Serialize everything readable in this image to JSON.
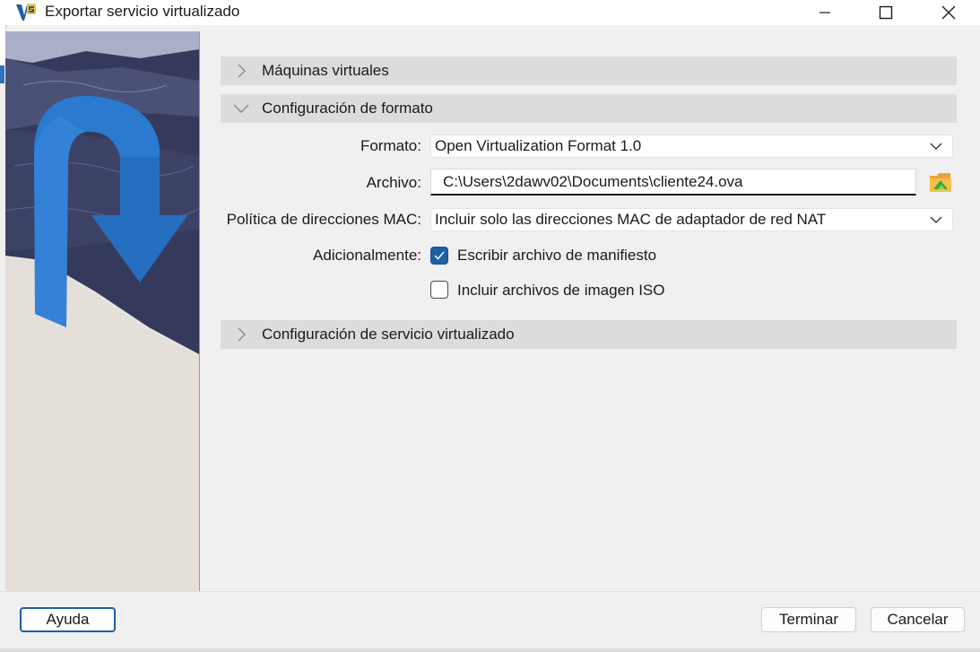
{
  "window": {
    "title": "Exportar servicio virtualizado"
  },
  "sections": {
    "machines": {
      "label": "Máquinas virtuales",
      "expanded": false
    },
    "format": {
      "label": "Configuración de formato",
      "expanded": true
    },
    "service": {
      "label": "Configuración de servicio virtualizado",
      "expanded": false
    }
  },
  "form": {
    "format_label": "Formato:",
    "format_value": "Open Virtualization Format 1.0",
    "file_label": "Archivo:",
    "file_value": "C:\\Users\\2dawv02\\Documents\\cliente24.ova",
    "mac_label": "Política de direcciones MAC:",
    "mac_value": "Incluir solo las direcciones MAC de adaptador de red NAT",
    "additional_label": "Adicionalmente:",
    "manifest_label": "Escribir archivo de manifiesto",
    "manifest_checked": true,
    "iso_label": "Incluir archivos de imagen ISO",
    "iso_checked": false
  },
  "buttons": {
    "help": "Ayuda",
    "finish": "Terminar",
    "cancel": "Cancelar"
  },
  "icons": {
    "app": "virtualbox-icon",
    "minimize": "minimize-icon",
    "maximize": "maximize-icon",
    "close": "close-icon",
    "folder": "folder-icon"
  },
  "colors": {
    "accent": "#1f5fa3",
    "section_bg": "#dcdcdc",
    "dialog_bg": "#f0f0f0"
  }
}
